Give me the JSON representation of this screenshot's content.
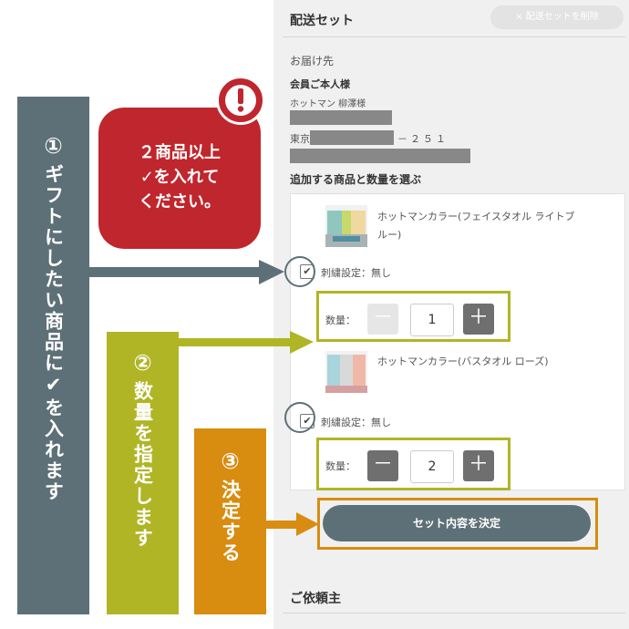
{
  "delivery_set": {
    "title": "配送セット",
    "delete_button": "× 配送セットを削除",
    "destination_label": "お届け先",
    "member_label": "会員ご本人様",
    "recipient_name": "ホットマン 柳澤様",
    "address_prefix": "東京",
    "address_suffix": "－２５１",
    "add_items_label": "追加する商品と数量を選ぶ",
    "confirm_button": "セット内容を決定"
  },
  "items": [
    {
      "name_line1": "ホットマンカラー(フェイスタオル ライトブ",
      "name_line2": "ルー)",
      "embroidery": "刺繍設定：無し",
      "qty_label": "数量：",
      "quantity": "1",
      "minus": "－",
      "plus": "＋",
      "checked": true
    },
    {
      "name_line1": "ホットマンカラー(バスタオル ローズ)",
      "name_line2": "",
      "embroidery": "刺繍設定：無し",
      "qty_label": "数量：",
      "quantity": "2",
      "minus": "－",
      "plus": "＋",
      "checked": true
    }
  ],
  "requester": {
    "title": "ご依頼主"
  },
  "annotations": {
    "warning_bubble": {
      "line1": "２商品以上",
      "line2": "✓を入れて",
      "line3": "ください。",
      "icon": "exclamation-icon"
    },
    "step1": {
      "number": "①",
      "text": "ギフトにしたい商品に✔を入れます"
    },
    "step2": {
      "number": "②",
      "text": "数量を指定します"
    },
    "step3": {
      "number": "③",
      "text": "決定する"
    }
  },
  "colors": {
    "slate": "#5e7077",
    "olive": "#b0b526",
    "orange": "#d88c10",
    "red": "#c0262d"
  }
}
